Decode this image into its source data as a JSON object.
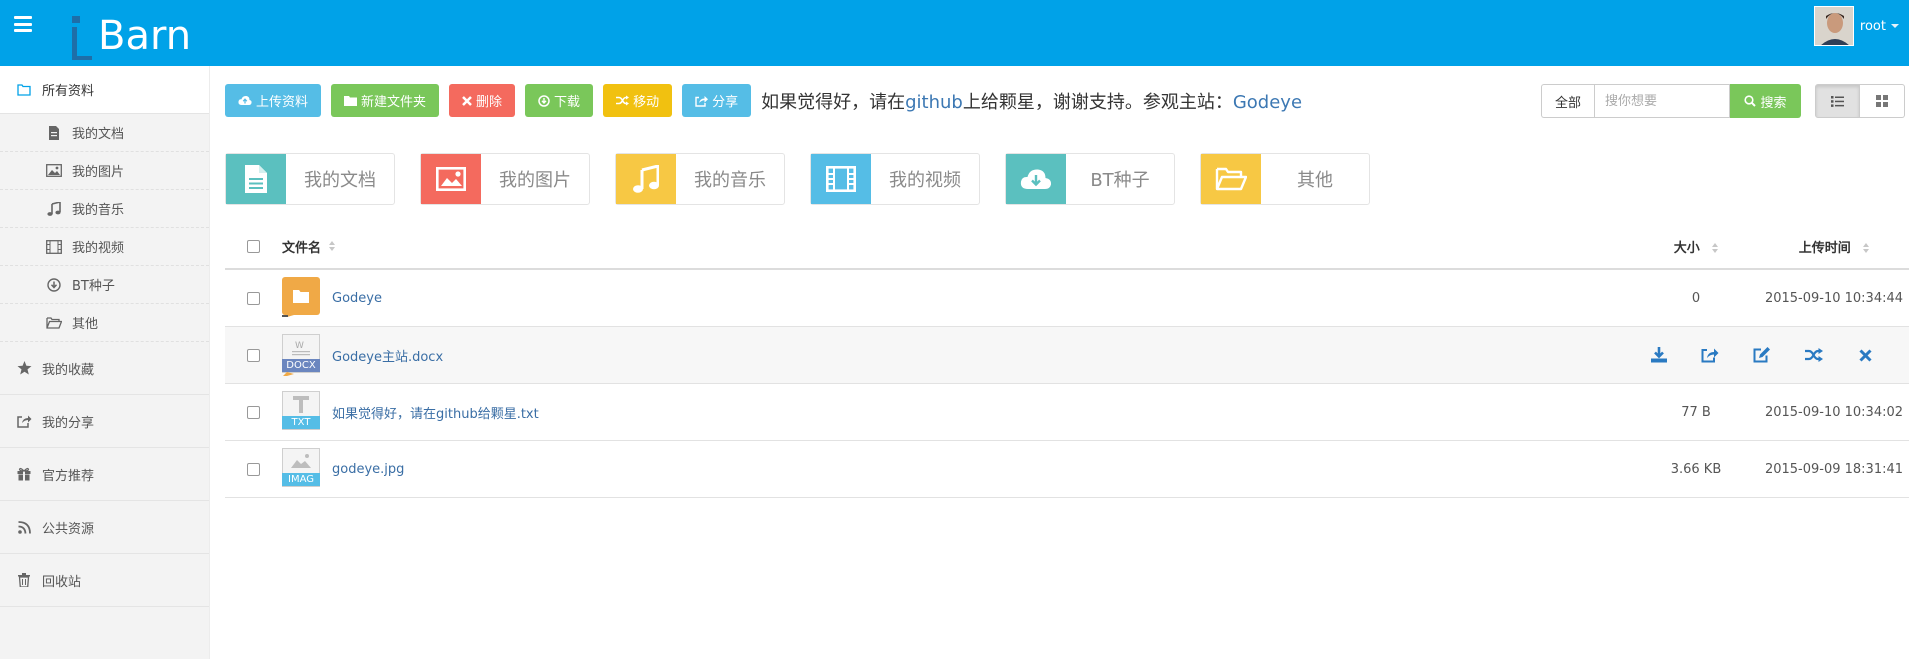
{
  "header": {
    "logo_text": "Barn",
    "logo_prefix": "i",
    "user_name": "root",
    "brand_color": "#00a2e8"
  },
  "sidebar": {
    "top_item": {
      "label": "所有资料",
      "icon": "folder-open-icon"
    },
    "sub_items": [
      {
        "label": "我的文档",
        "icon": "file-icon"
      },
      {
        "label": "我的图片",
        "icon": "picture-icon"
      },
      {
        "label": "我的音乐",
        "icon": "music-icon"
      },
      {
        "label": "我的视频",
        "icon": "film-icon"
      },
      {
        "label": "BT种子",
        "icon": "download-circle-icon"
      },
      {
        "label": "其他",
        "icon": "folder-icon"
      }
    ],
    "items": [
      {
        "label": "我的收藏",
        "icon": "star-icon"
      },
      {
        "label": "我的分享",
        "icon": "share-icon"
      },
      {
        "label": "官方推荐",
        "icon": "gift-icon"
      },
      {
        "label": "公共资源",
        "icon": "rss-icon"
      },
      {
        "label": "回收站",
        "icon": "trash-icon"
      }
    ]
  },
  "toolbar": {
    "upload": "上传资料",
    "new_folder": "新建文件夹",
    "delete": "删除",
    "download": "下载",
    "move": "移动",
    "share": "分享",
    "notice_prefix": "如果觉得好，请在",
    "notice_github": "github",
    "notice_middle": "上给颗星，谢谢支持。参观主站：",
    "notice_link": "Godeye"
  },
  "search": {
    "scope": "全部",
    "placeholder": "搜你想要",
    "button": "搜索"
  },
  "categories": [
    {
      "label": "我的文档",
      "color": "#5bc0bf",
      "icon": "file-text-icon"
    },
    {
      "label": "我的图片",
      "color": "#f46a5e",
      "icon": "picture-icon"
    },
    {
      "label": "我的音乐",
      "color": "#f7c844",
      "icon": "music-icon"
    },
    {
      "label": "我的视频",
      "color": "#55bde6",
      "icon": "film-icon"
    },
    {
      "label": "BT种子",
      "color": "#5bc0bf",
      "icon": "cloud-download-icon"
    },
    {
      "label": "其他",
      "color": "#f7c844",
      "icon": "folder-open-icon"
    }
  ],
  "table": {
    "headers": {
      "name": "文件名",
      "size": "大小",
      "time": "上传时间"
    },
    "rows": [
      {
        "name": "Godeye",
        "type": "folder",
        "badge": "",
        "size": "0",
        "time": "2015-09-10 10:34:44"
      },
      {
        "name": "Godeye主站.docx",
        "type": "docx",
        "badge": "DOCX",
        "size": "",
        "time": ""
      },
      {
        "name": "如果觉得好，请在github给颗星.txt",
        "type": "txt",
        "badge": "TXT",
        "size": "77 B",
        "time": "2015-09-10 10:34:02"
      },
      {
        "name": "godeye.jpg",
        "type": "image",
        "badge": "IMAG",
        "size": "3.66 KB",
        "time": "2015-09-09 18:31:41"
      }
    ]
  }
}
